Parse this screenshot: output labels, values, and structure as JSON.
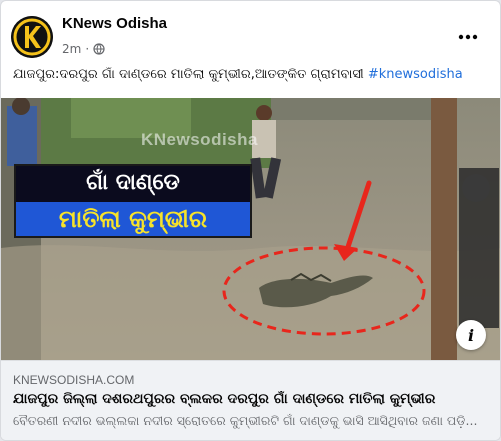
{
  "post": {
    "page_name": "KNews Odisha",
    "time": "2m",
    "privacy_icon": "globe-icon",
    "more_icon": "more-horizontal-icon",
    "caption_text": "ଯାଜପୁର:ଦରପୁର ଗାଁ ଦାଣ୍ଡରେ ମାତିଲା କୁମ୍ଭୀର,ଆତଙ୍କିତ ଗ୍ରାମବାସୀ ",
    "hashtag": "#knewsodisha"
  },
  "media": {
    "overlay_line1": "ଗାଁ ଦାଣ୍ଡେ",
    "overlay_line2": "ମାତିଲା କୁମ୍ଭୀର",
    "watermark": "KNewsodisha",
    "info_label": "i",
    "annotation_color": "#e8261c"
  },
  "link": {
    "domain": "KNEWSODISHA.COM",
    "title": "ଯାଜପୁର ଜିଲ୍ଲା ଦଶରଥପୁରର ବ୍ଲକର ଦରପୁର ଗାଁ ଦାଣ୍ଡରେ ମାତିଲା କୁମ୍ଭୀର",
    "description": "ବୈତରଣୀ ନଦୀର ଭଲ୍ଲକା ନଦୀର ସ୍ରୋତରେ କୁମ୍ଭୀରଟି ଗାଁ ଦାଣ୍ଡକୁ ଭାସି ଆସିଥିବାର ଜଣା ପଡ଼ି..."
  },
  "colors": {
    "brand_yellow": "#f5c21b",
    "hashtag_blue": "#216fdb"
  }
}
